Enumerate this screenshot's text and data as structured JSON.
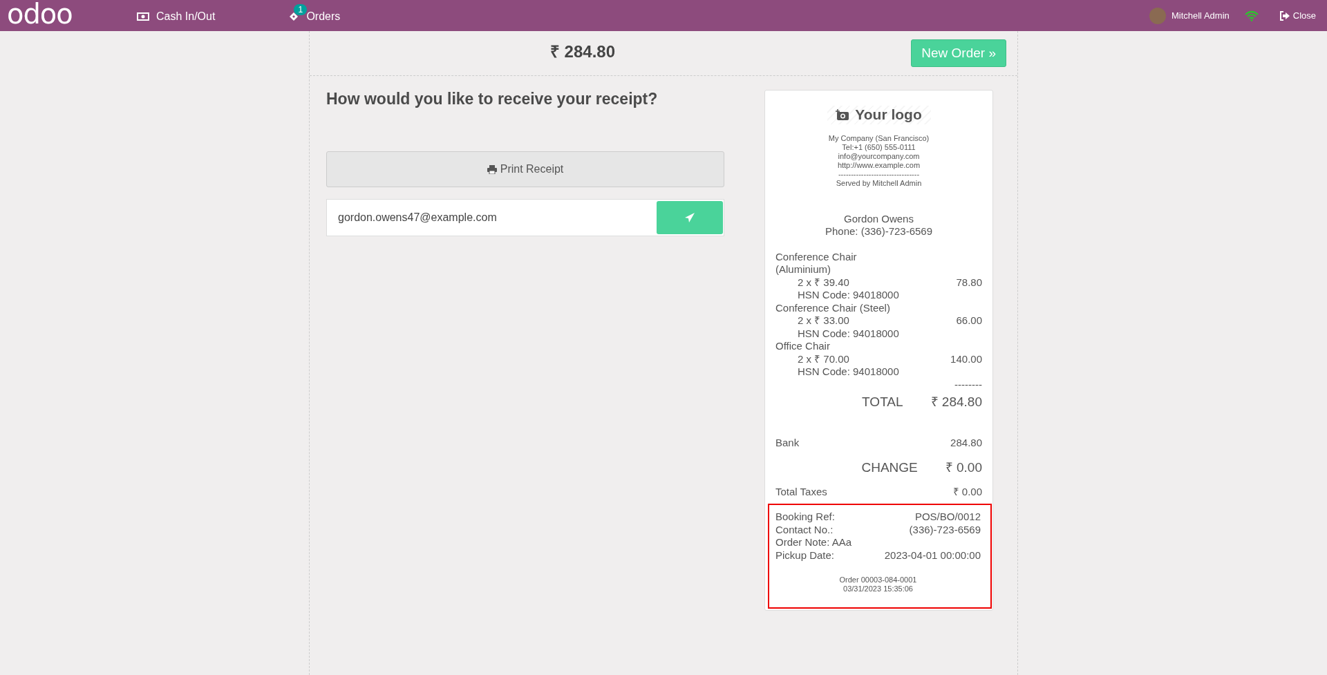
{
  "topbar": {
    "logo": "odoo",
    "nav": [
      {
        "kind": "cash",
        "label": "Cash In/Out"
      },
      {
        "kind": "orders",
        "label": "Orders",
        "badge": "1"
      }
    ],
    "user": "Mitchell Admin",
    "close": "Close"
  },
  "header": {
    "amount": "₹ 284.80",
    "new_order": "New Order",
    "chevron": "»"
  },
  "receipt_options": {
    "question": "How would you like to receive your receipt?",
    "print_button": "Print Receipt",
    "email": "gordon.owens47@example.com"
  },
  "receipt": {
    "logo": "Your logo",
    "company": [
      "My Company (San Francisco)",
      "Tel:+1 (650) 555-0111",
      "info@yourcompany.com",
      "http://www.example.com",
      "--------------------------------",
      "Served by Mitchell Admin"
    ],
    "customer": [
      "Gordon Owens",
      "Phone: (336)-723-6569"
    ],
    "lines": [
      {
        "product": "Conference Chair (Aluminium)",
        "qty_price": "2 x ₹ 39.40",
        "amount": "78.80",
        "hsn": "HSN Code: 94018000"
      },
      {
        "product": "Conference Chair (Steel)",
        "qty_price": "2 x ₹ 33.00",
        "amount": "66.00",
        "hsn": "HSN Code: 94018000"
      },
      {
        "product": "Office Chair",
        "qty_price": "2 x ₹ 70.00",
        "amount": "140.00",
        "hsn": "HSN Code: 94018000"
      }
    ],
    "separator": "--------",
    "total_label": "TOTAL",
    "total": "₹ 284.80",
    "payment": {
      "label": "Bank",
      "amount": "284.80"
    },
    "change_label": "CHANGE",
    "change": "₹ 0.00",
    "taxes_label": "Total Taxes",
    "taxes": "₹ 0.00",
    "booking": [
      {
        "label": "Booking Ref:",
        "value": "POS/BO/0012"
      },
      {
        "label": "Contact No.:",
        "value": "(336)-723-6569"
      },
      {
        "label": "Order Note: AAa"
      },
      {
        "label": "Pickup Date:",
        "value": "2023-04-01 00:00:00"
      }
    ],
    "footer": [
      "Order 00003-084-0001",
      "03/31/2023 15:35:06"
    ]
  }
}
